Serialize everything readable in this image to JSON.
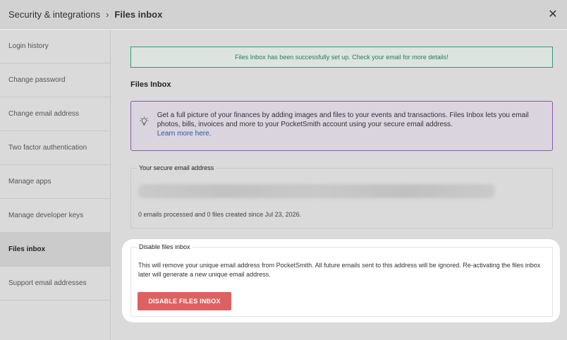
{
  "header": {
    "breadcrumb_parent": "Security & integrations",
    "breadcrumb_separator": "›",
    "breadcrumb_current": "Files inbox",
    "close_glyph": "✕"
  },
  "sidebar": {
    "items": [
      {
        "label": "Login history"
      },
      {
        "label": "Change password"
      },
      {
        "label": "Change email address"
      },
      {
        "label": "Two factor authentication"
      },
      {
        "label": "Manage apps"
      },
      {
        "label": "Manage developer keys"
      },
      {
        "label": "Files inbox",
        "active": true
      },
      {
        "label": "Support email addresses"
      }
    ]
  },
  "main": {
    "success_message": "Files Inbox has been successfully set up. Check your email for more details!",
    "section_title": "Files Inbox",
    "info_text": "Get a full picture of your finances by adding images and files to your events and transactions. Files Inbox lets you email photos, bills, invoices and more to your PocketSmith account using your secure email address.",
    "info_link": "Learn more here.",
    "email_legend": "Your secure email address",
    "email_stats": "0 emails processed and 0 files created since Jul 23, 2026.",
    "disable_legend": "Disable files inbox",
    "disable_text": "This will remove your unique email address from PocketSmith. All future emails sent to this address will be ignored. Re-activating the files inbox later will generate a new unique email address.",
    "disable_button": "DISABLE FILES INBOX"
  },
  "colors": {
    "success": "#2a9d7b",
    "info_border": "#8a5aa8",
    "danger": "#dd6161",
    "link": "#2c5aa0"
  },
  "icons": {
    "info": "lightbulb-icon",
    "close": "close-icon"
  }
}
